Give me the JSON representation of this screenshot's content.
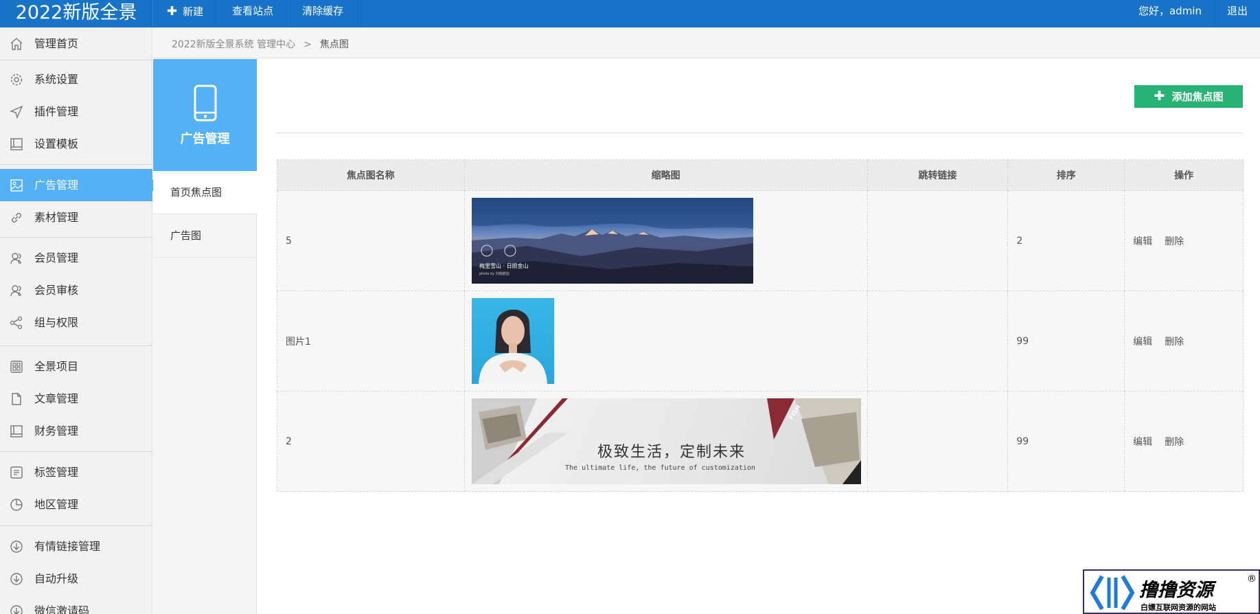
{
  "topbar": {
    "brand": "2022新版全景",
    "nav": [
      {
        "label": "新建",
        "icon": "plus-icon"
      },
      {
        "label": "查看站点"
      },
      {
        "label": "清除缓存"
      }
    ],
    "greeting": "您好，admin",
    "logout": "退出",
    "color": "#1773c8"
  },
  "sidebar": {
    "items": [
      {
        "label": "管理首页",
        "icon": "home-icon"
      },
      {
        "label": "系统设置",
        "icon": "gear-icon"
      },
      {
        "label": "插件管理",
        "icon": "send-icon"
      },
      {
        "label": "设置模板",
        "icon": "book-icon"
      },
      {
        "label": "广告管理",
        "icon": "image-icon",
        "active": true
      },
      {
        "label": "素材管理",
        "icon": "link-icon"
      },
      {
        "label": "会员管理",
        "icon": "users-icon"
      },
      {
        "label": "会员审核",
        "icon": "users-check-icon"
      },
      {
        "label": "组与权限",
        "icon": "share-icon"
      },
      {
        "label": "全景项目",
        "icon": "grid-icon"
      },
      {
        "label": "文章管理",
        "icon": "file-icon"
      },
      {
        "label": "财务管理",
        "icon": "ledger-icon"
      },
      {
        "label": "标签管理",
        "icon": "list-icon"
      },
      {
        "label": "地区管理",
        "icon": "pie-icon"
      },
      {
        "label": "有情链接管理",
        "icon": "download-icon"
      },
      {
        "label": "自动升级",
        "icon": "download-icon"
      },
      {
        "label": "微信激请码",
        "icon": "download-icon"
      }
    ],
    "active_color": "#55b1f5"
  },
  "breadcrumb": {
    "root": "2022新版全景系统 管理中心",
    "separator": ">",
    "current": "焦点图"
  },
  "subnav": {
    "title": "广告管理",
    "icon": "phone-icon",
    "items": [
      {
        "label": "首页焦点图",
        "active": true
      },
      {
        "label": "广告图"
      }
    ]
  },
  "main": {
    "add_button": "添加焦点图",
    "add_button_color": "#27b276",
    "table": {
      "headers": [
        "焦点图名称",
        "缩略图",
        "跳转链接",
        "排序",
        "操作"
      ],
      "rows": [
        {
          "name": "5",
          "thumb": "mountain",
          "link": "",
          "sort": "2",
          "edit": "编辑",
          "delete": "删除",
          "thumb_text": {
            "caption": "梅里雪山 · 日照金山",
            "credit": "photo by 刘锐航拍"
          }
        },
        {
          "name": "图片1",
          "thumb": "person",
          "link": "",
          "sort": "99",
          "edit": "编辑",
          "delete": "删除"
        },
        {
          "name": "2",
          "thumb": "banner",
          "link": "",
          "sort": "99",
          "edit": "编辑",
          "delete": "删除",
          "thumb_text": {
            "headline": "极致生活，定制未来",
            "tagline": "The ultimate life, the future of customization",
            "corner": "FISH"
          }
        }
      ]
    }
  },
  "watermark": {
    "title": "撸撸资源",
    "registered": "®",
    "subtitle": "白嫖互联网资源的网站"
  }
}
